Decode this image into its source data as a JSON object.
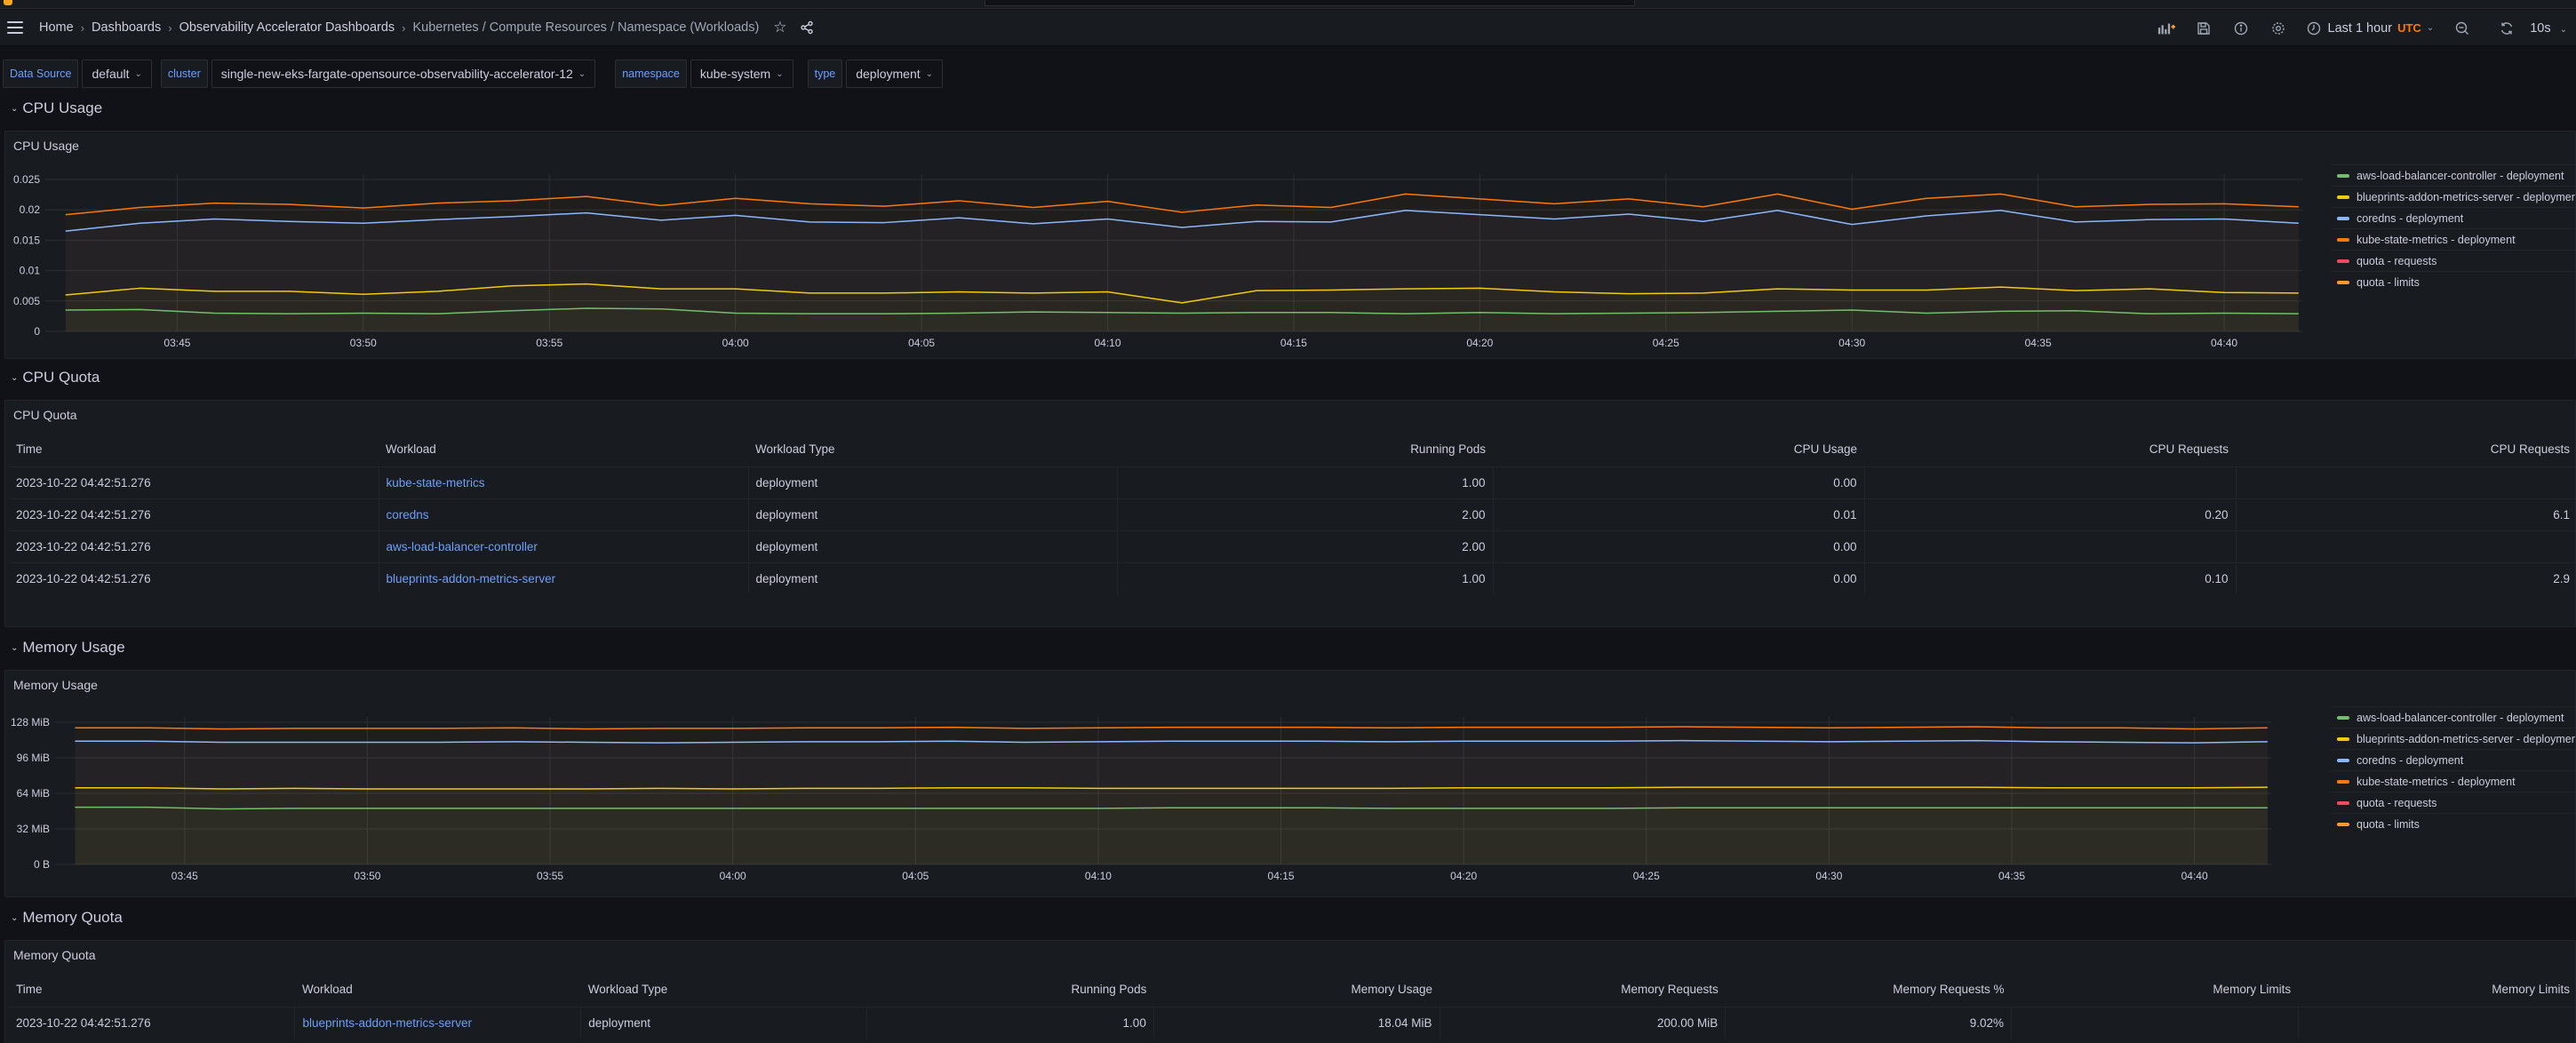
{
  "header": {
    "breadcrumbs": [
      "Home",
      "Dashboards",
      "Observability Accelerator Dashboards",
      "Kubernetes / Compute Resources / Namespace (Workloads)"
    ],
    "time_range": "Last 1 hour",
    "timezone": "UTC",
    "refresh_interval": "10s",
    "icons": [
      "menu-icon",
      "star-icon",
      "share-icon",
      "add-panel-icon",
      "save-icon",
      "info-icon",
      "settings-icon",
      "clock-icon",
      "zoom-out-icon",
      "refresh-icon"
    ]
  },
  "variables": [
    {
      "label": "Data Source",
      "value": "default"
    },
    {
      "label": "cluster",
      "value": "single-new-eks-fargate-opensource-observability-accelerator-12"
    },
    {
      "label": "namespace",
      "value": "kube-system"
    },
    {
      "label": "type",
      "value": "deployment"
    }
  ],
  "rows": {
    "cpu_usage": "CPU Usage",
    "cpu_quota": "CPU Quota",
    "memory_usage": "Memory Usage",
    "memory_quota": "Memory Quota"
  },
  "series_colors": {
    "aws-load-balancer-controller": "#73bf69",
    "blueprints-addon-metrics-server": "#f2cc0c",
    "coredns": "#8ab8ff",
    "kube-state-metrics": "#ff780a",
    "quota-requests": "#f2495c",
    "quota-limits": "#ff9830"
  },
  "chart_data": [
    {
      "type": "line",
      "title": "CPU Usage",
      "xlabel": "",
      "ylabel": "",
      "x": [
        "03:42",
        "03:44",
        "03:46",
        "03:48",
        "03:50",
        "03:52",
        "03:54",
        "03:56",
        "03:58",
        "04:00",
        "04:02",
        "04:04",
        "04:06",
        "04:08",
        "04:10",
        "04:12",
        "04:14",
        "04:16",
        "04:18",
        "04:20",
        "04:22",
        "04:24",
        "04:26",
        "04:28",
        "04:30",
        "04:32",
        "04:34",
        "04:36",
        "04:38",
        "04:40",
        "04:42"
      ],
      "x_ticks": [
        "03:45",
        "03:50",
        "03:55",
        "04:00",
        "04:05",
        "04:10",
        "04:15",
        "04:20",
        "04:25",
        "04:30",
        "04:35",
        "04:40"
      ],
      "y_ticks": [
        "0",
        "0.005",
        "0.01",
        "0.015",
        "0.02",
        "0.025"
      ],
      "ylim": [
        0,
        0.025
      ],
      "grid": true,
      "legend_position": "right",
      "series": [
        {
          "name": "aws-load-balancer-controller - deployment",
          "key": "aws-load-balancer-controller",
          "values": [
            0.0035,
            0.0036,
            0.003,
            0.0029,
            0.003,
            0.0029,
            0.0034,
            0.0038,
            0.0037,
            0.003,
            0.0029,
            0.0029,
            0.003,
            0.0032,
            0.0031,
            0.003,
            0.0031,
            0.0031,
            0.0029,
            0.0031,
            0.0029,
            0.003,
            0.0031,
            0.0033,
            0.0035,
            0.003,
            0.0033,
            0.0034,
            0.0029,
            0.003,
            0.0029
          ]
        },
        {
          "name": "blueprints-addon-metrics-server - deployment",
          "key": "blueprints-addon-metrics-server",
          "values": [
            0.006,
            0.0071,
            0.0066,
            0.0066,
            0.0061,
            0.0066,
            0.0075,
            0.0078,
            0.007,
            0.007,
            0.0063,
            0.0063,
            0.0065,
            0.0063,
            0.0065,
            0.0047,
            0.0067,
            0.0068,
            0.007,
            0.0071,
            0.0065,
            0.0062,
            0.0063,
            0.007,
            0.0068,
            0.0068,
            0.0073,
            0.0067,
            0.007,
            0.0064,
            0.0063
          ]
        },
        {
          "name": "coredns - deployment",
          "key": "coredns",
          "values": [
            0.0165,
            0.0178,
            0.0185,
            0.0181,
            0.0178,
            0.0184,
            0.0189,
            0.0195,
            0.0183,
            0.0191,
            0.018,
            0.0179,
            0.0187,
            0.0177,
            0.0185,
            0.0171,
            0.0181,
            0.018,
            0.0199,
            0.0192,
            0.0185,
            0.0193,
            0.0181,
            0.0199,
            0.0176,
            0.019,
            0.0199,
            0.018,
            0.0184,
            0.0185,
            0.0178
          ]
        },
        {
          "name": "kube-state-metrics - deployment",
          "key": "kube-state-metrics",
          "values": [
            0.0192,
            0.0204,
            0.0211,
            0.0209,
            0.0203,
            0.0211,
            0.0215,
            0.0222,
            0.0207,
            0.0219,
            0.021,
            0.0206,
            0.0215,
            0.0204,
            0.0214,
            0.0196,
            0.0208,
            0.0204,
            0.0226,
            0.0218,
            0.021,
            0.0218,
            0.0205,
            0.0226,
            0.0201,
            0.0219,
            0.0226,
            0.0205,
            0.0209,
            0.021,
            0.0205
          ]
        },
        {
          "name": "quota - requests",
          "key": "quota-requests",
          "values": []
        },
        {
          "name": "quota - limits",
          "key": "quota-limits",
          "values": []
        }
      ]
    },
    {
      "type": "line",
      "title": "Memory Usage",
      "xlabel": "",
      "ylabel": "",
      "x": [
        "03:42",
        "03:44",
        "03:46",
        "03:48",
        "03:50",
        "03:52",
        "03:54",
        "03:56",
        "03:58",
        "04:00",
        "04:02",
        "04:04",
        "04:06",
        "04:08",
        "04:10",
        "04:12",
        "04:14",
        "04:16",
        "04:18",
        "04:20",
        "04:22",
        "04:24",
        "04:26",
        "04:28",
        "04:30",
        "04:32",
        "04:34",
        "04:36",
        "04:38",
        "04:40",
        "04:42"
      ],
      "x_ticks": [
        "03:45",
        "03:50",
        "03:55",
        "04:00",
        "04:05",
        "04:10",
        "04:15",
        "04:20",
        "04:25",
        "04:30",
        "04:35",
        "04:40"
      ],
      "y_ticks": [
        "0 B",
        "32 MiB",
        "64 MiB",
        "96 MiB",
        "128 MiB"
      ],
      "ylim_mib": [
        0,
        128
      ],
      "unit": "MiB",
      "grid": true,
      "legend_position": "right",
      "series": [
        {
          "name": "aws-load-balancer-controller - deployment",
          "key": "aws-load-balancer-controller",
          "values": [
            51.5,
            51.5,
            50.0,
            50.5,
            50.5,
            50.5,
            50.5,
            50.5,
            50.5,
            50.5,
            50.5,
            50.5,
            50.5,
            50.5,
            50.5,
            51.0,
            51.0,
            51.0,
            50.5,
            50.5,
            50.5,
            50.5,
            51.0,
            51.0,
            51.0,
            51.0,
            51.0,
            51.0,
            51.0,
            51.0,
            51.0
          ]
        },
        {
          "name": "blueprints-addon-metrics-server - deployment",
          "key": "blueprints-addon-metrics-server",
          "values": [
            69.0,
            69.0,
            68.0,
            68.5,
            68.0,
            68.0,
            68.0,
            68.0,
            68.5,
            68.0,
            68.5,
            68.5,
            69.0,
            69.0,
            68.5,
            68.5,
            68.5,
            68.5,
            68.5,
            69.0,
            69.0,
            69.0,
            69.5,
            69.5,
            69.5,
            69.5,
            69.5,
            69.0,
            69.0,
            69.0,
            69.5
          ]
        },
        {
          "name": "coredns - deployment",
          "key": "coredns",
          "values": [
            111.0,
            111.0,
            110.0,
            110.0,
            110.0,
            110.0,
            110.5,
            110.0,
            109.5,
            110.0,
            110.5,
            110.5,
            111.0,
            110.0,
            110.5,
            111.0,
            111.0,
            111.0,
            110.5,
            111.0,
            111.0,
            111.0,
            111.5,
            111.0,
            110.5,
            111.0,
            111.5,
            110.5,
            110.0,
            109.5,
            110.5
          ]
        },
        {
          "name": "kube-state-metrics - deployment",
          "key": "kube-state-metrics",
          "values": [
            123.0,
            123.0,
            122.0,
            122.5,
            122.5,
            122.5,
            123.0,
            122.0,
            122.5,
            122.5,
            123.0,
            123.0,
            123.5,
            122.5,
            123.0,
            123.5,
            123.5,
            123.5,
            123.0,
            123.5,
            123.5,
            123.5,
            124.0,
            123.5,
            123.0,
            123.5,
            124.0,
            123.0,
            123.0,
            122.0,
            123.0
          ]
        },
        {
          "name": "quota - requests",
          "key": "quota-requests",
          "values": []
        },
        {
          "name": "quota - limits",
          "key": "quota-limits",
          "values": []
        }
      ]
    }
  ],
  "cpu_quota_table": {
    "title": "CPU Quota",
    "columns": [
      "Time",
      "Workload",
      "Workload Type",
      "Running Pods",
      "CPU Usage",
      "CPU Requests",
      "CPU Requests"
    ],
    "rows": [
      [
        "2023-10-22 04:42:51.276",
        "kube-state-metrics",
        "deployment",
        "1.00",
        "0.00",
        "",
        ""
      ],
      [
        "2023-10-22 04:42:51.276",
        "coredns",
        "deployment",
        "2.00",
        "0.01",
        "0.20",
        "6.1"
      ],
      [
        "2023-10-22 04:42:51.276",
        "aws-load-balancer-controller",
        "deployment",
        "2.00",
        "0.00",
        "",
        ""
      ],
      [
        "2023-10-22 04:42:51.276",
        "blueprints-addon-metrics-server",
        "deployment",
        "1.00",
        "0.00",
        "0.10",
        "2.9"
      ]
    ]
  },
  "memory_quota_table": {
    "title": "Memory Quota",
    "columns": [
      "Time",
      "Workload",
      "Workload Type",
      "Running Pods",
      "Memory Usage",
      "Memory Requests",
      "Memory Requests %",
      "Memory Limits",
      "Memory Limits"
    ],
    "rows": [
      [
        "2023-10-22 04:42:51.276",
        "blueprints-addon-metrics-server",
        "deployment",
        "1.00",
        "18.04 MiB",
        "200.00 MiB",
        "9.02%",
        "",
        ""
      ]
    ]
  }
}
